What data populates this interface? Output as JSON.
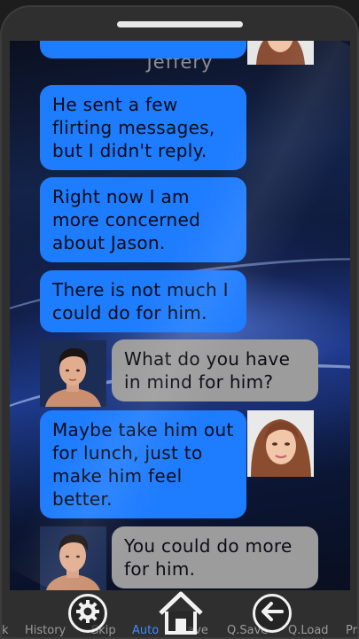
{
  "header": {
    "contact_name": "Jeffery"
  },
  "messages": [
    {
      "from": "her",
      "text": ""
    },
    {
      "from": "her",
      "text": "He sent a few flirting messages, but I didn't reply."
    },
    {
      "from": "her",
      "text": "Right now I am more concerned about Jason."
    },
    {
      "from": "her",
      "text": "There is not much I could do for him."
    },
    {
      "from": "me",
      "text": "What do you have in mind for him?"
    },
    {
      "from": "her",
      "text": "Maybe take him out for lunch, just to make him feel better."
    },
    {
      "from": "me",
      "text": "You could do more for him."
    }
  ],
  "quick_menu": {
    "items": [
      "k",
      "History",
      "Skip",
      "Auto",
      "Save",
      "Q.Save",
      "Q.Load",
      "Pr"
    ],
    "active": "Auto"
  },
  "icons": {
    "settings": "gear-icon",
    "home": "home-icon",
    "back": "back-arrow-icon"
  },
  "colors": {
    "her_bubble": "#1e7cff",
    "me_bubble": "#9c9c9c",
    "active_menu": "#3e8dff"
  }
}
